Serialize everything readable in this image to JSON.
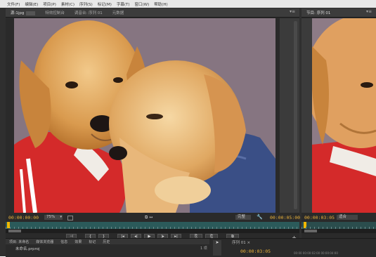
{
  "menu": [
    "文件(F)",
    "编辑(E)",
    "项目(P)",
    "素材(C)",
    "序列(S)",
    "标记(M)",
    "字幕(T)",
    "窗口(W)",
    "帮助(H)"
  ],
  "source_monitor": {
    "tabs": [
      "源:1jpg",
      "特效控制台",
      "调音台: 序列 01",
      "元数据"
    ],
    "panel_menu": "▾≡",
    "timecode_left": "00:00:00:00",
    "zoom": "75%",
    "fit": "完整",
    "timecode_right": "00:00:05:00",
    "marks": "⧉ ↔"
  },
  "controls": [
    "⊣",
    "{",
    "}",
    "|◂",
    "◂|",
    "▶",
    "|▸",
    "▸|",
    "⎘",
    "⎗",
    "⧉"
  ],
  "add_button": "+",
  "program_monitor": {
    "tab": "节目: 序列 01",
    "panel_menu": "▾≡",
    "timecode_left": "00:00:03:05",
    "fit": "适合"
  },
  "bottom": {
    "tabs": [
      "项目: 未命名",
      "媒体浏览器",
      "信息",
      "效果",
      "标记",
      "历史"
    ],
    "project_file": "未命名.prproj",
    "item_count": "1 项",
    "sequence_tab": "序列 01 ×",
    "sequence_timecode": "00:00:03:05",
    "ruler": "00:00   00:00:02:00   00:00:04:00"
  },
  "colors": {
    "timecode": "#e8b13a",
    "timeline": "#2b5a5a",
    "panel": "#2a2a2a"
  },
  "image": {
    "subject": "two golden retriever puppies in red and blue jackets"
  }
}
